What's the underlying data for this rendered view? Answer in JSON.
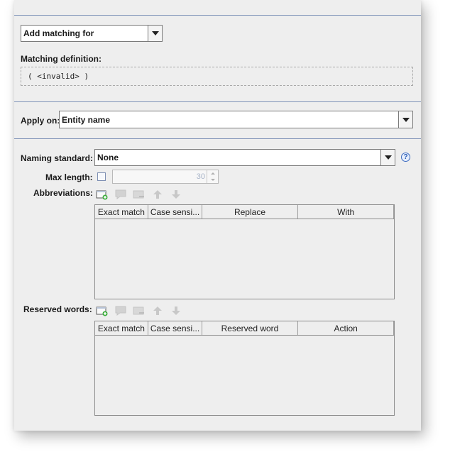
{
  "matching": {
    "add_matching_value": "Add matching for",
    "definition_label": "Matching definition:",
    "definition_value": "( <invalid> )"
  },
  "apply": {
    "label": "Apply on:",
    "value": "Entity name"
  },
  "naming": {
    "label": "Naming standard:",
    "value": "None",
    "help_symbol": "?"
  },
  "max_length": {
    "label": "Max length:",
    "value": "30"
  },
  "abbreviations": {
    "label": "Abbreviations:",
    "columns": [
      "Exact match",
      "Case sensi...",
      "Replace",
      "With"
    ]
  },
  "reserved_words": {
    "label": "Reserved words:",
    "columns": [
      "Exact match",
      "Case sensi...",
      "Reserved word",
      "Action"
    ]
  },
  "icons": {
    "add": "add-row-icon",
    "comment": "comment-icon",
    "remove": "remove-row-icon",
    "up": "arrow-up-icon",
    "down": "arrow-down-icon"
  },
  "colors": {
    "panel_bg": "#eeeeee",
    "separator": "#7f93b8",
    "add_icon_green": "#3cae3c",
    "disabled_icon": "#c4c4c4"
  }
}
